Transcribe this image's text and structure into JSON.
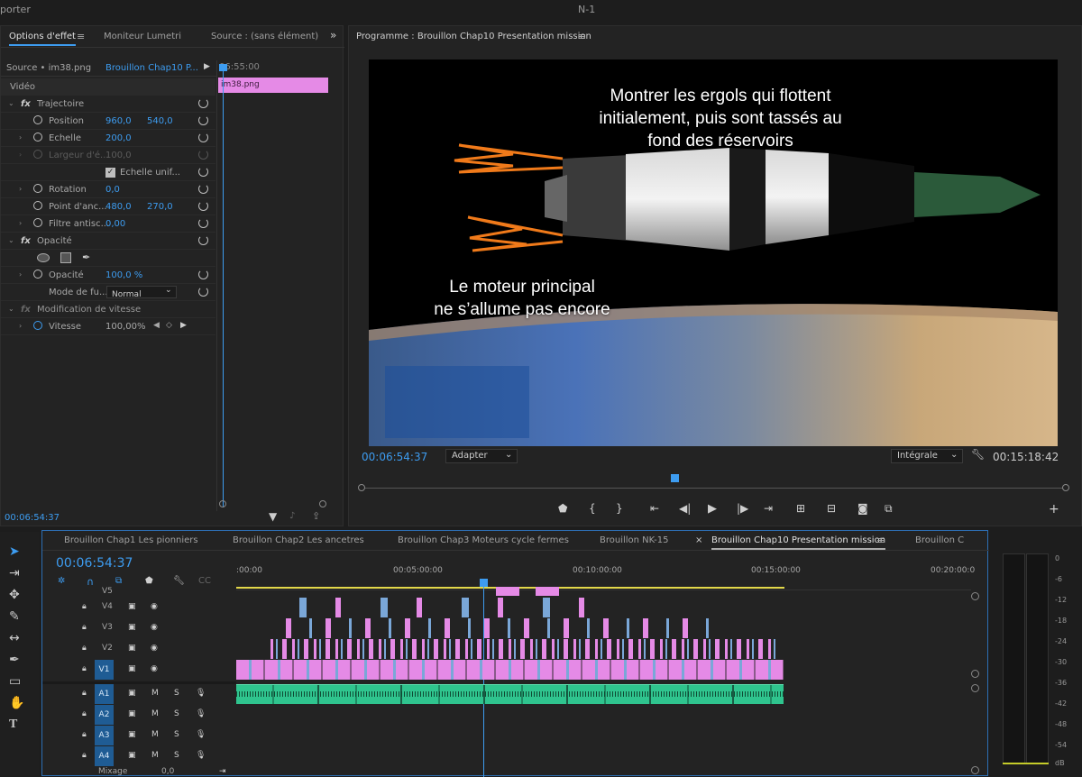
{
  "app": {
    "left_title": "porter",
    "center_title": "N-1"
  },
  "effects": {
    "tabs": [
      "Options d'effet",
      "Moniteur Lumetri",
      "Source : (sans élément)"
    ],
    "source_label": "Source • im38.png",
    "sequence_label": "Brouillon Chap10 P...",
    "timecode_top": "06:55:00",
    "clip_label": "im38.png",
    "section_video": "Vidéo",
    "rows": [
      {
        "label": "Trajectoire",
        "fx": true
      },
      {
        "label": "Position",
        "v1": "960,0",
        "v2": "540,0"
      },
      {
        "label": "Echelle",
        "v1": "200,0"
      },
      {
        "label": "Largeur d'é...",
        "v1": "100,0",
        "dim": true
      },
      {
        "label": "Echelle unif...",
        "check": true
      },
      {
        "label": "Rotation",
        "v1": "0,0"
      },
      {
        "label": "Point d'anc...",
        "v1": "480,0",
        "v2": "270,0"
      },
      {
        "label": "Filtre antisc...",
        "v1": "0,00"
      },
      {
        "label": "Opacité",
        "fx": true
      },
      {
        "label": "Opacité",
        "v1": "100,0 %"
      },
      {
        "label": "Mode de fu...",
        "select": "Normal"
      },
      {
        "label": "Modification de vitesse",
        "fx": true,
        "dim": true
      },
      {
        "label": "Vitesse",
        "v1": "100,00%"
      }
    ],
    "timecode_bottom": "00:06:54:37"
  },
  "program": {
    "title": "Programme : Brouillon Chap10 Presentation mission",
    "caption_top": [
      "Montrer les ergols qui flottent",
      "initialement, puis sont tassés au",
      "fond des réservoirs"
    ],
    "caption_bottom": [
      "Le moteur principal",
      "ne s’allume pas encore"
    ],
    "timecode": "00:06:54:37",
    "fit": "Adapter",
    "quality": "Intégrale",
    "duration": "00:15:18:42"
  },
  "timeline": {
    "tabs": [
      "Brouillon Chap1 Les pionniers",
      "Brouillon Chap2 Les ancetres",
      "Brouillon Chap3 Moteurs cycle fermes",
      "Brouillon NK-15",
      "Brouillon Chap10 Presentation mission",
      "Brouillon C"
    ],
    "timecode": "00:06:54:37",
    "ruler": [
      ":00:00",
      "00:05:00:00",
      "00:10:00:00",
      "00:15:00:00",
      "00:20:00:0"
    ],
    "video_tracks": [
      "V5",
      "V4",
      "V3",
      "V2",
      "V1"
    ],
    "audio_tracks": [
      "A1",
      "A2",
      "A3",
      "A4"
    ],
    "mix_label": "Mixage",
    "mix_value": "0,0",
    "track_m": "M",
    "track_s": "S"
  },
  "meter": {
    "scale": [
      "0",
      "-6",
      "-12",
      "-18",
      "-24",
      "-30",
      "-36",
      "-42",
      "-48",
      "-54",
      "dB"
    ]
  },
  "colors": {
    "accent": "#3d9cf0",
    "pink": "#e58ae6",
    "clip_blue": "#7aa7d8",
    "audio": "#2fc48e"
  }
}
